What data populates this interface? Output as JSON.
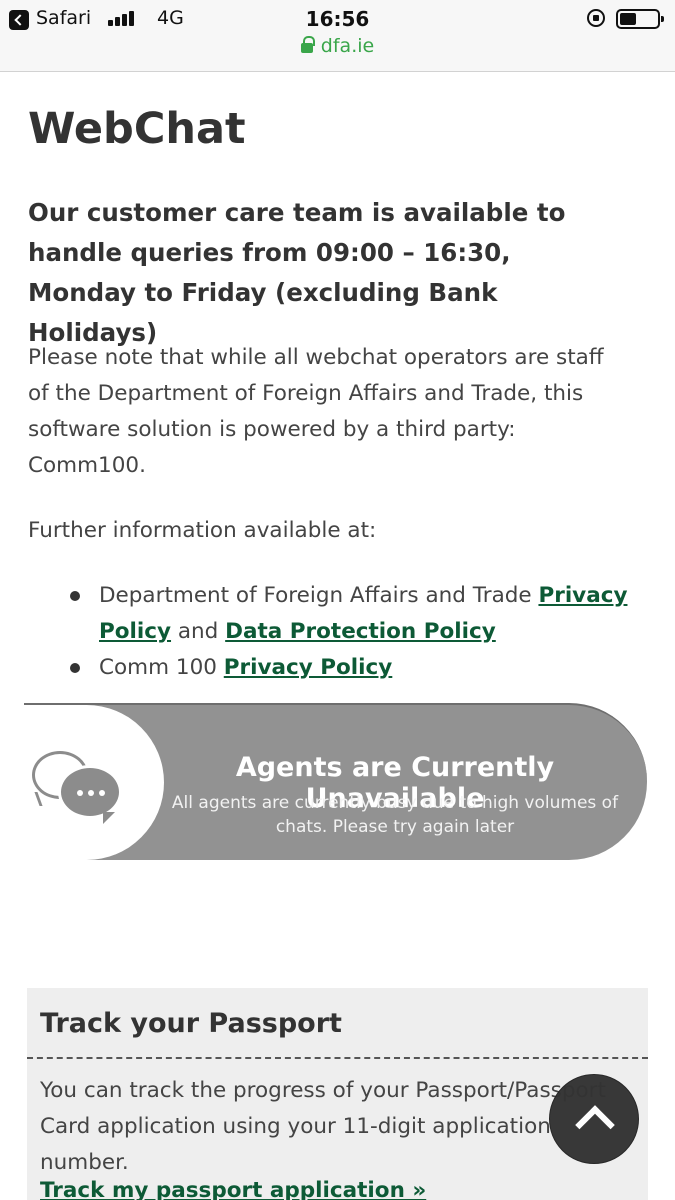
{
  "status_bar": {
    "app": "Safari",
    "network": "4G",
    "time": "16:56",
    "url": "dfa.ie"
  },
  "page": {
    "title": "WebChat",
    "lead": "Our customer care team is available to handle queries from 09:00 – 16:30, Monday to Friday (excluding Bank Holidays)",
    "note": "Please note that while all webchat operators are staff of the Department of Foreign Affairs and Trade, this software solution is powered by a third party: Comm100.",
    "further": "Further information available at:",
    "links": [
      {
        "prefix": "Department of Foreign Affairs and Trade ",
        "link1": "Privacy Policy",
        "middle": " and ",
        "link2": "Data Protection Policy"
      },
      {
        "prefix": "Comm 100 ",
        "link1": "Privacy Policy"
      }
    ]
  },
  "chat_banner": {
    "heading": "Agents are Currently Unavailable",
    "subtext": "All agents are currently busy due to high volumes of chats. Please try again later",
    "icon": "chat-bubbles-icon"
  },
  "passport": {
    "title": "Track your Passport",
    "text": "You can track the progress of your Passport/Passport Card application using your 11-digit application number.",
    "link": "Track my passport application »"
  },
  "controls": {
    "back_to_top_icon": "chevron-up-icon"
  },
  "colors": {
    "link": "#0d5a36",
    "secure_url": "#3aa64a",
    "banner": "#929292"
  }
}
